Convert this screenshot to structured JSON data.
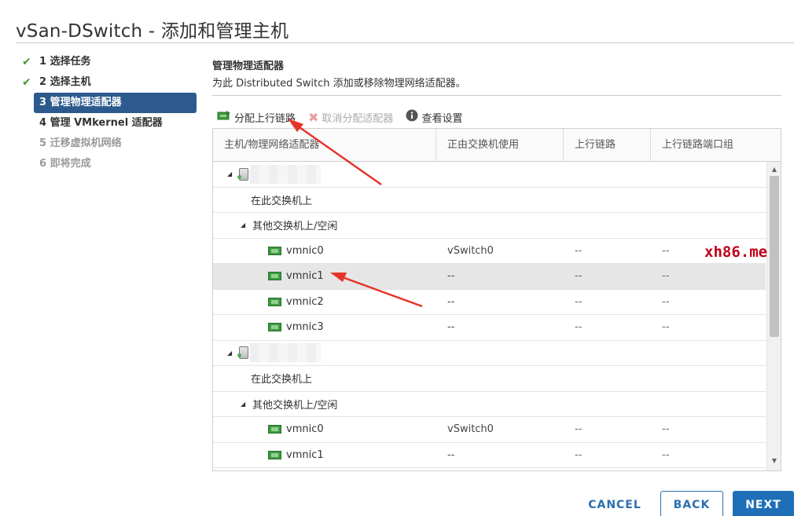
{
  "dialog": {
    "title": "vSan-DSwitch - 添加和管理主机"
  },
  "steps": [
    {
      "label": "1 选择任务",
      "state": "done"
    },
    {
      "label": "2 选择主机",
      "state": "done"
    },
    {
      "label": "3 管理物理适配器",
      "state": "active"
    },
    {
      "label": "4 管理 VMkernel 适配器",
      "state": "pending"
    },
    {
      "label": "5 迁移虚拟机网络",
      "state": "disabled"
    },
    {
      "label": "6 即将完成",
      "state": "disabled"
    }
  ],
  "section": {
    "title": "管理物理适配器",
    "description": "为此 Distributed Switch 添加或移除物理网络适配器。"
  },
  "toolbar": {
    "assign_uplink": "分配上行链路",
    "unassign_adapter": "取消分配适配器",
    "view_settings": "查看设置"
  },
  "table": {
    "columns": [
      "主机/物理网络适配器",
      "正由交换机使用",
      "上行链路",
      "上行链路端口组"
    ],
    "rows": [
      {
        "type": "host"
      },
      {
        "type": "group",
        "label": "在此交换机上"
      },
      {
        "type": "group-expand",
        "label": "其他交换机上/空闲"
      },
      {
        "type": "nic",
        "name": "vmnic0",
        "switch": "vSwitch0",
        "uplink": "--",
        "portgroup": "--"
      },
      {
        "type": "nic",
        "name": "vmnic1",
        "switch": "--",
        "uplink": "--",
        "portgroup": "--",
        "selected": true
      },
      {
        "type": "nic",
        "name": "vmnic2",
        "switch": "--",
        "uplink": "--",
        "portgroup": "--"
      },
      {
        "type": "nic",
        "name": "vmnic3",
        "switch": "--",
        "uplink": "--",
        "portgroup": "--"
      },
      {
        "type": "host"
      },
      {
        "type": "group",
        "label": "在此交换机上"
      },
      {
        "type": "group-expand",
        "label": "其他交换机上/空闲"
      },
      {
        "type": "nic",
        "name": "vmnic0",
        "switch": "vSwitch0",
        "uplink": "--",
        "portgroup": "--"
      },
      {
        "type": "nic",
        "name": "vmnic1",
        "switch": "--",
        "uplink": "--",
        "portgroup": "--"
      }
    ]
  },
  "watermark": "xh86.me",
  "buttons": {
    "cancel": "CANCEL",
    "back": "BACK",
    "next": "NEXT"
  },
  "colors": {
    "accent": "#2d5a8e",
    "primary_button": "#1e6fb8",
    "check": "#4a9a2f",
    "arrow": "#e8332a"
  }
}
